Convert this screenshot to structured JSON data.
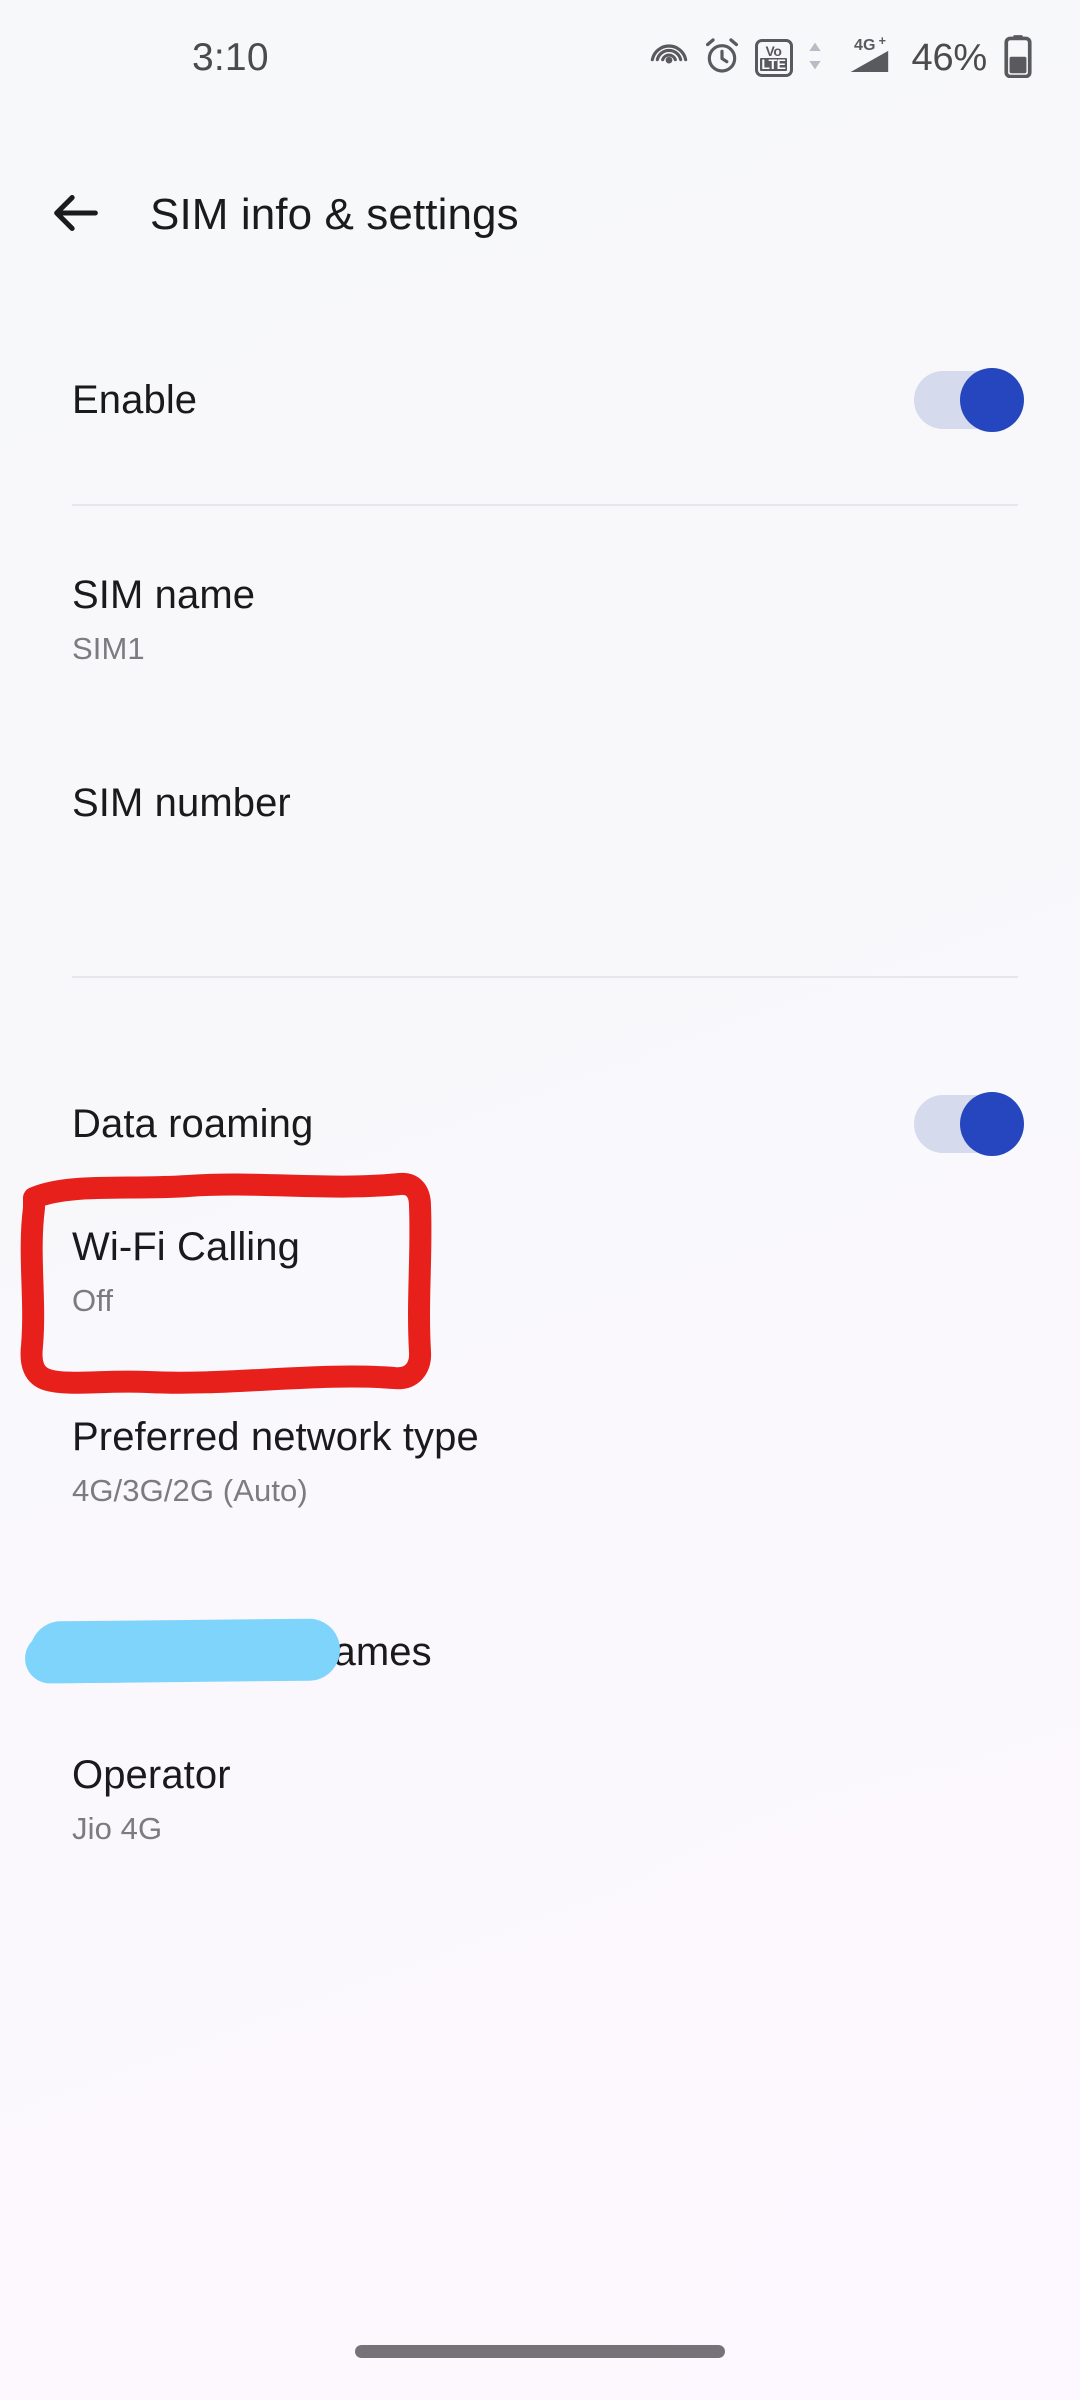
{
  "status_bar": {
    "time": "3:10",
    "battery_percent": "46%",
    "network_label": "4G+",
    "volte_top": "Vo",
    "volte_bottom": "LTE",
    "icons": [
      "hotspot-icon",
      "alarm-icon",
      "volte-icon",
      "data-arrows-icon",
      "signal-icon",
      "battery-icon"
    ]
  },
  "appbar": {
    "back_icon": "back-arrow-icon",
    "title": "SIM info & settings"
  },
  "rows": {
    "enable": {
      "title": "Enable",
      "toggle_state": "on"
    },
    "sim_name": {
      "title": "SIM name",
      "subtitle": "SIM1"
    },
    "sim_number": {
      "title": "SIM number",
      "subtitle": ""
    },
    "data_roaming": {
      "title": "Data roaming",
      "toggle_state": "on"
    },
    "wifi_calling": {
      "title": "Wi-Fi Calling",
      "subtitle": "Off"
    },
    "preferred_network_type": {
      "title": "Preferred network type",
      "subtitle": "4G/3G/2G (Auto)"
    },
    "access_point_names": {
      "title": "Access point names",
      "subtitle": ""
    },
    "operator": {
      "title": "Operator",
      "subtitle": "Jio 4G"
    }
  },
  "annotations": {
    "redaction_color": "#7fd4fb",
    "highlight_color": "#e8201c",
    "highlight_target": "wifi_calling"
  },
  "colors": {
    "toggle_track": "#d5daec",
    "toggle_thumb": "#2546be",
    "title_text": "#1a1a1c",
    "subtitle_text": "#7b7b80",
    "divider": "#e6e7ec",
    "background": "#f7f8fa",
    "nav_pill": "#77717a"
  }
}
